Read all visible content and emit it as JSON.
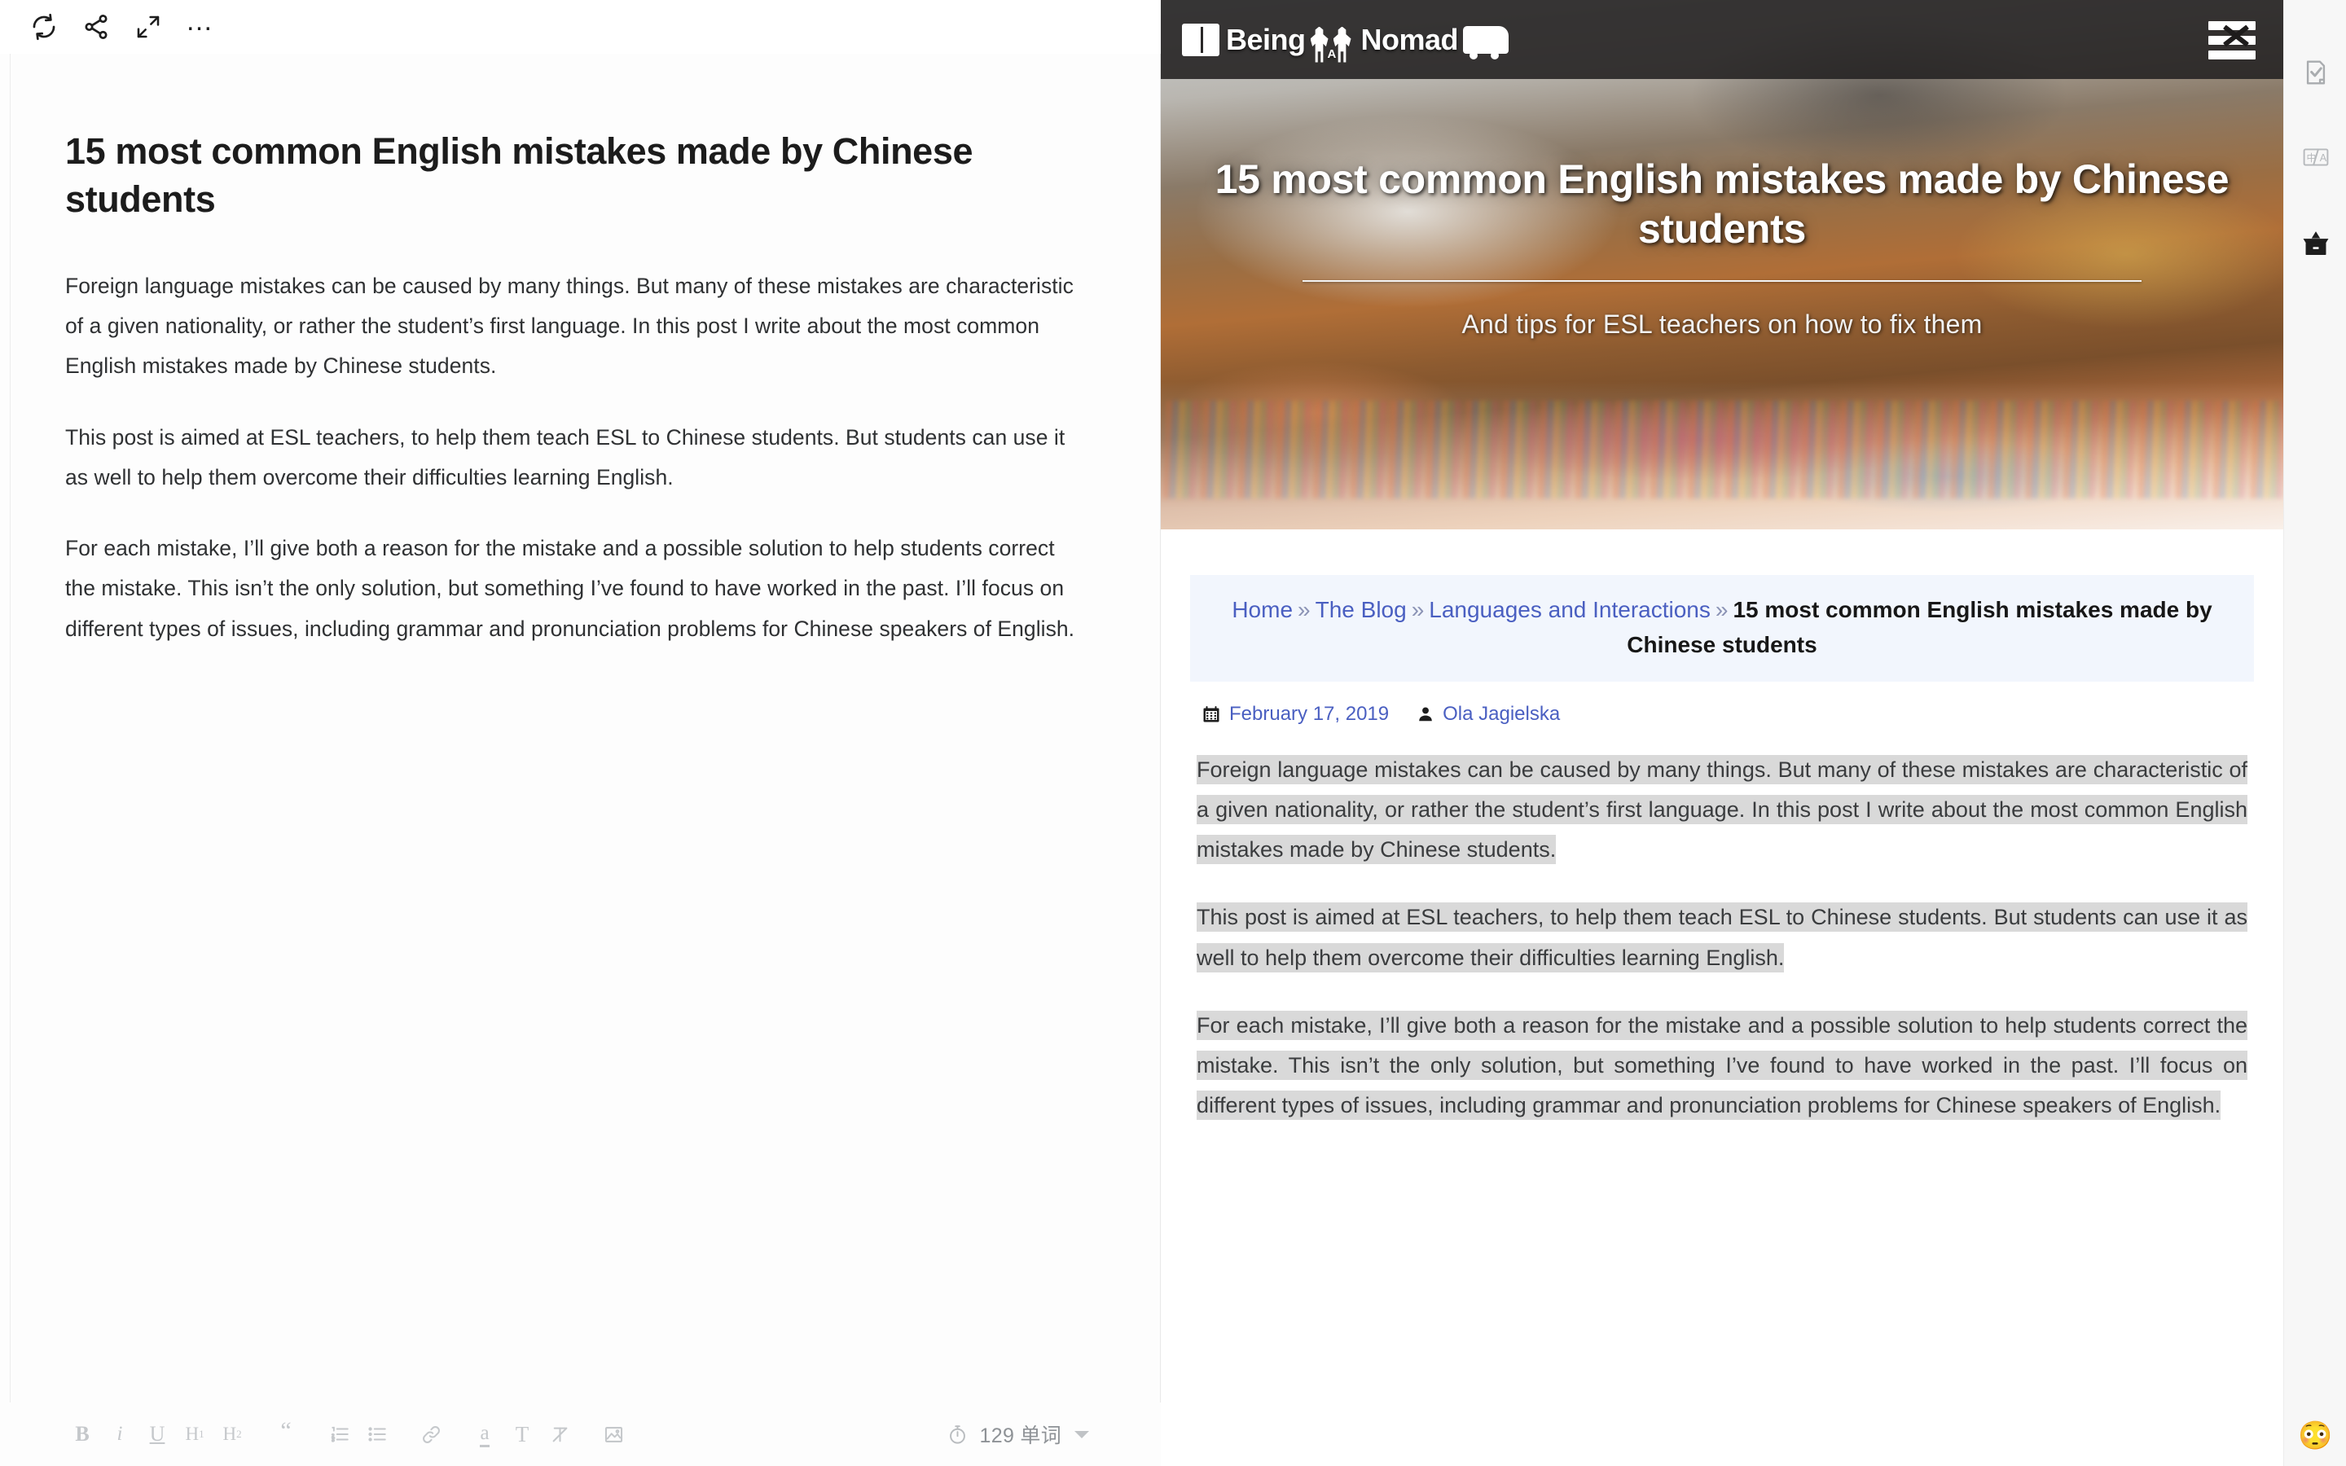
{
  "editor": {
    "toolbar": {
      "sync_label": "sync",
      "share_label": "share",
      "fullscreen_label": "fullscreen",
      "more_label": "…"
    },
    "document": {
      "title": "15 most common English mistakes made by Chinese students",
      "paragraphs": [
        "Foreign language mistakes can be caused by many things. But many of these mistakes are characteristic of a given nationality, or rather the student’s first language. In this post I write about the most common English mistakes made by Chinese students.",
        "This post is aimed at ESL teachers, to help them teach ESL to Chinese students. But students can use it as well to help them overcome their difficulties learning English.",
        "For each mistake, I’ll give both a reason for the mistake and a possible solution to help students correct the mistake. This isn’t the only solution, but something I’ve found to have worked in the past. I’ll focus on different types of issues, including grammar and pronunciation problems for Chinese speakers of English."
      ]
    },
    "format_toolbar": {
      "bold": "B",
      "italic": "i",
      "underline": "U",
      "heading1": "H",
      "heading1_sub": "1",
      "heading2": "H",
      "heading2_sub": "2",
      "blockquote": "“",
      "ordered_list": "ordered-list",
      "unordered_list": "unordered-list",
      "link": "link",
      "highlight": "a",
      "text_style": "T",
      "clear_format": "clear-format",
      "insert_image": "image"
    },
    "status": {
      "word_count": "129 单词",
      "timer_icon": "stopwatch"
    }
  },
  "preview": {
    "site": {
      "brand_being": "Being",
      "brand_a": "A",
      "brand_nomad": "Nomad",
      "menu_label": "menu"
    },
    "hero": {
      "title": "15 most common English mistakes made by Chinese students",
      "subtitle": "And tips for ESL teachers on how to fix them"
    },
    "breadcrumb": {
      "items": [
        {
          "label": "Home",
          "link": true
        },
        {
          "label": "The Blog",
          "link": true
        },
        {
          "label": "Languages and Interactions",
          "link": true
        }
      ],
      "separator": "»",
      "current": "15 most common English mistakes made by Chinese students"
    },
    "meta": {
      "date": "February 17, 2019",
      "author": "Ola Jagielska",
      "date_icon": "calendar",
      "author_icon": "user"
    },
    "paragraphs": [
      "Foreign language mistakes can be caused by many things. But many of these mistakes are characteristic of a given nationality, or rather the student’s first language. In this post I write about the most common English mistakes made by Chinese students.",
      "This post is aimed at ESL teachers, to help them teach ESL to Chinese students. But students can use it as well to help them overcome their difficulties learning English.",
      "For each mistake, I’ll give both a reason for the mistake and a possible solution to help students correct the mistake. This isn’t the only solution, but something I’ve found to have worked in the past. I’ll focus on different types of issues, including grammar and pronunciation problems for Chinese speakers of English."
    ]
  },
  "right_rail": {
    "items": [
      {
        "name": "document-check",
        "label": "proofread"
      },
      {
        "name": "translate",
        "label": "translate"
      },
      {
        "name": "collection-box",
        "label": "collection"
      }
    ],
    "emoji": "😳"
  },
  "colors": {
    "accent_link": "#4a5fc1",
    "selection": "#d9d9d9",
    "breadcrumb_bg": "#f2f6fd",
    "topbar_dark": "#262424"
  }
}
